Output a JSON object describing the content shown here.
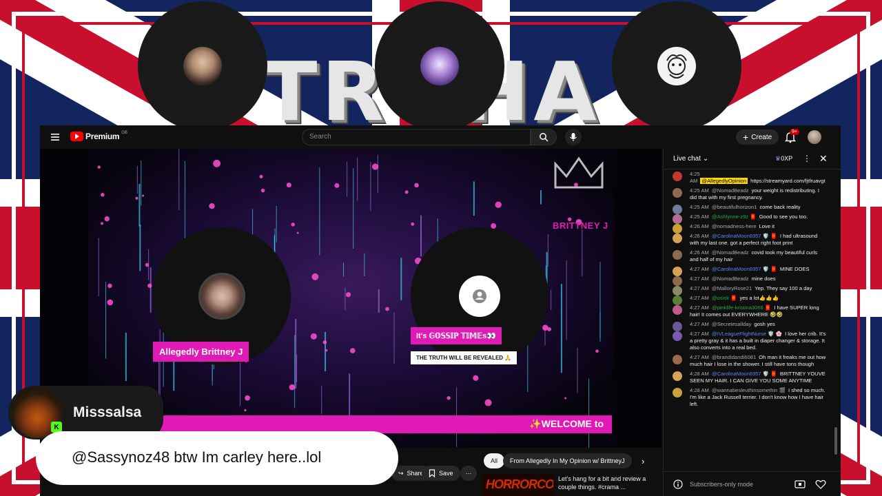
{
  "banner": {
    "word": "TROHA"
  },
  "colors": {
    "flag_blue": "#14245e",
    "flag_red": "#c8102e",
    "accent_pink": "#e01ab4",
    "yt_red": "#ff0000",
    "bg_dark": "#0f0f0f"
  },
  "youtube": {
    "logo_text": "Premium",
    "logo_region": "GB",
    "search_placeholder": "Search",
    "create_label": "Create",
    "notifications_count": "9+",
    "icons": [
      "menu-icon",
      "search-icon",
      "mic-icon",
      "plus-icon",
      "bell-icon"
    ]
  },
  "video": {
    "brand_text": "BRITTNEY J",
    "speaker1_name": "Allegedly Brittney J",
    "speaker2_name": "It's 𝔾𝕆𝕊𝕊𝕀ℙ 𝕋𝕀𝕄𝔼s👀",
    "speaker2_sub": "THE TRUTH WILL BE REVEALED 🙏",
    "welcome_text": "✨WELCOME to"
  },
  "below": {
    "share_label": "Share",
    "save_label": "Save",
    "more_label": "···",
    "filter_all": "All",
    "filter_from": "From Allegedly In My Opinion w/ BrittneyJ",
    "rec_thumb_text": "HORRORCOW",
    "rec_title": "Let's hang for a bit and review a couple things. #crama ..."
  },
  "chat": {
    "title": "Live chat",
    "xp": "0XP",
    "input_placeholder": "Subscribers-only mode",
    "messages": [
      {
        "time": "4:25 AM",
        "author": "@AllegedlyOpinion",
        "role": "hl",
        "text": "https://streamyard.com/fjtfruavgt",
        "avatar": "#c0392b"
      },
      {
        "time": "4:25 AM",
        "author": "@NomadBeadz",
        "role": "",
        "text": "your weight is redistributing. I did that with my first pregnancy.",
        "avatar": "#8e6b4f"
      },
      {
        "time": "4:25 AM",
        "author": "@beautifulhorizon1",
        "role": "",
        "text": "come back reality",
        "avatar": "#6a7f9a"
      },
      {
        "time": "4:25 AM",
        "author": "@Ashlynne-z9z 🧧",
        "role": "mem",
        "text": "Good to see you too.",
        "avatar": "#b46f8f"
      },
      {
        "time": "4:26 AM",
        "author": "@nomadness-here",
        "role": "",
        "text": "Love it",
        "avatar": "#c9a13a"
      },
      {
        "time": "4:26 AM",
        "author": "@CarolinaMoon8357 🛡️ 🧧",
        "role": "mod",
        "text": "I had ultrasound with my last one. got a perfect right foot print",
        "avatar": "#d4a35a"
      },
      {
        "time": "4:26 AM",
        "author": "@NomadBeadz",
        "role": "",
        "text": "covid took my beautiful curls and half of my hair",
        "avatar": "#8e6b4f"
      },
      {
        "time": "4:27 AM",
        "author": "@CarolinaMoon8357 🛡️ 🧧",
        "role": "mod",
        "text": "MINE DOES",
        "avatar": "#d4a35a"
      },
      {
        "time": "4:27 AM",
        "author": "@NomadBeadz",
        "role": "",
        "text": "mine does",
        "avatar": "#8e6b4f"
      },
      {
        "time": "4:27 AM",
        "author": "@MalloryRose21",
        "role": "",
        "text": "Yep. They say 100 a day",
        "avatar": "#8a8a6a"
      },
      {
        "time": "4:27 AM",
        "author": "@osisk 🧧",
        "role": "mem",
        "text": "yes a lot👍👍👍",
        "avatar": "#5b7f3a"
      },
      {
        "time": "4:27 AM",
        "author": "@pinklife-kristina3066 🧧",
        "role": "mem",
        "text": "I have SUPER long hair! It comes out EVERYWHERE 🤣🤣",
        "avatar": "#c25a8a"
      },
      {
        "time": "4:27 AM",
        "author": "@Secretesallday",
        "role": "",
        "text": "gosh yes",
        "avatar": "#6b5a9a"
      },
      {
        "time": "4:27 AM",
        "author": "@IVLeagueFlightNurse 🛡️ 🌸",
        "role": "mod",
        "text": "I love her crib. It's a pretty gray & it has a built in diaper changer & storage. It also converts into a real bed.",
        "avatar": "#7a5ab0"
      },
      {
        "time": "4:27 AM",
        "author": "@brandidandi6081",
        "role": "",
        "text": "Oh man it freaks me out how much hair I lose in the shower. I still have tons though",
        "avatar": "#9a6a4a"
      },
      {
        "time": "4:28 AM",
        "author": "@CarolinaMoon8357 🛡️ 🧧",
        "role": "mod",
        "text": "BRITTNEY YOUVE SEEN MY HAIR. I CAN GIVE YOU SOME ANYTIME",
        "avatar": "#d4a35a"
      },
      {
        "time": "4:28 AM",
        "author": "@wannabesleuthinsomethin 🎬",
        "role": "",
        "text": "I shed so much. I'm like a Jack Russell terrier. I don't know how I have hair left.",
        "avatar": "#c9a13a"
      }
    ]
  },
  "overlay": {
    "username": "Misssalsa",
    "badge": "K",
    "message": "@Sassynoz48 btw Im carley here..lol"
  }
}
